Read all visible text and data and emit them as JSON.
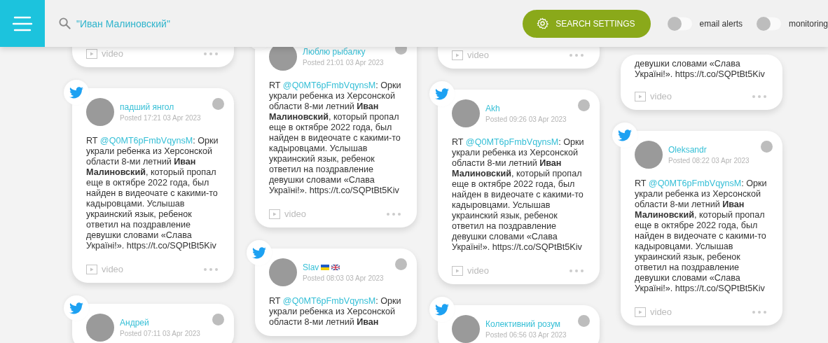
{
  "header": {
    "search": {
      "value": "\"Иван Малиновский\""
    },
    "settings_button": "SEARCH SETTINGS",
    "toggles": [
      {
        "label": "email alerts",
        "on": false
      },
      {
        "label": "monitoring",
        "on": false
      }
    ]
  },
  "columns": [
    {
      "posts": [
        {
          "media": "video"
        },
        {
          "author": "падший янгол",
          "posted": "Posted 17:21 03 Apr 2023",
          "prefix": "RT",
          "mention": "@Q0MT6pFmbVqynsM",
          "text": ": Орки украли ребенка из Херсонской области 8-ми летний **Иван Малиновский**, который пропал еще в октябре 2022 года, был найден в видеочате с какими-то кадыровцами. Услышав украинский язык, ребенок ответил на поздравление девушки словами «Слава Українi!». https://t.co/SQPtBt5Kiv",
          "media": "video"
        },
        {
          "author": "Андрей",
          "posted": "Posted 07:11 03 Apr 2023"
        }
      ]
    },
    {
      "posts": [
        {
          "author": "Люблю рыбалку",
          "posted": "Posted 21:01 03 Apr 2023",
          "prefix": "RT",
          "mention": "@Q0MT6pFmbVqynsM",
          "text": ": Орки украли ребенка из Херсонской области 8-ми летний **Иван Малиновский**, который пропал еще в октябре 2022 года, был найден в видеочате с какими-то кадыровцами. Услышав украинский язык, ребенок ответил на поздравление девушки словами «Слава Українi!». https://t.co/SQPtBt5Kiv",
          "media": "video"
        },
        {
          "author": "Slav",
          "flags": [
            {
              "kind": "ua"
            },
            {
              "kind": "gb"
            }
          ],
          "posted": "Posted 08:03 03 Apr 2023",
          "prefix": "RT",
          "mention": "@Q0MT6pFmbVqynsM",
          "text": ": Орки украли ребенка из Херсонской области 8-ми летний **Иван**"
        }
      ]
    },
    {
      "posts": [
        {
          "media": "video"
        },
        {
          "author": "Akh",
          "posted": "Posted 09:26 03 Apr 2023",
          "prefix": "RT",
          "mention": "@Q0MT6pFmbVqynsM",
          "text": ": Орки украли ребенка из Херсонской области 8-ми летний **Иван Малиновский**, который пропал еще в октябре 2022 года, был найден в видеочате с какими-то кадыровцами. Услышав украинский язык, ребенок ответил на поздравление девушки словами «Слава Українi!». https://t.co/SQPtBt5Kiv",
          "media": "video"
        },
        {
          "author": "Колективний розум",
          "posted": "Posted 06:56 03 Apr 2023"
        }
      ]
    },
    {
      "posts": [
        {
          "text": "девушки словами «Слава Українi!». https://t.co/SQPtBt5Kiv",
          "media": "video"
        },
        {
          "author": "Oleksandr",
          "posted": "Posted 08:22 03 Apr 2023",
          "prefix": "RT",
          "mention": "@Q0MT6pFmbVqynsM",
          "text": ": Орки украли ребенка из Херсонской области 8-ми летний **Иван Малиновский**, который пропал еще в октябре 2022 года, был найден в видеочате с какими-то кадыровцами. Услышав украинский язык, ребенок ответил на поздравление девушки словами «Слава Українi!». https://t.co/SQPtBt5Kiv",
          "media": "video"
        }
      ]
    }
  ]
}
